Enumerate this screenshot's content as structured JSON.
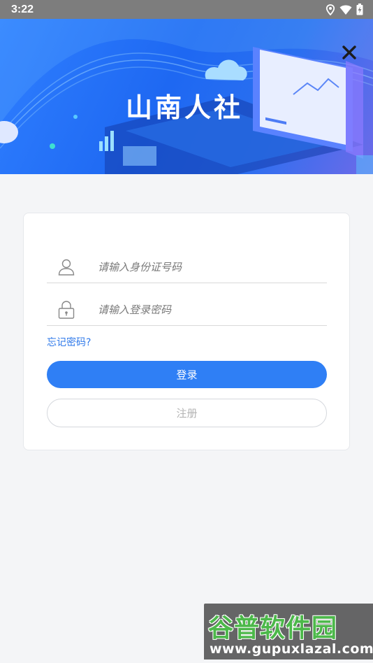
{
  "status_bar": {
    "time": "3:22"
  },
  "banner": {
    "title": "山南人社"
  },
  "login_form": {
    "id_placeholder": "请输入身份证号码",
    "password_placeholder": "请输入登录密码",
    "forgot_label": "忘记密码?",
    "login_label": "登录",
    "register_label": "注册"
  },
  "watermark": {
    "title": "谷普软件园",
    "url": "www.gupuxlazal.com"
  },
  "colors": {
    "primary": "#2f7ff5",
    "link": "#2f79ea",
    "background": "#f4f5f7",
    "status_bar": "#7d7d7d"
  },
  "icons": [
    "location-icon",
    "wifi-icon",
    "battery-icon",
    "close-icon",
    "user-icon",
    "lock-icon"
  ]
}
